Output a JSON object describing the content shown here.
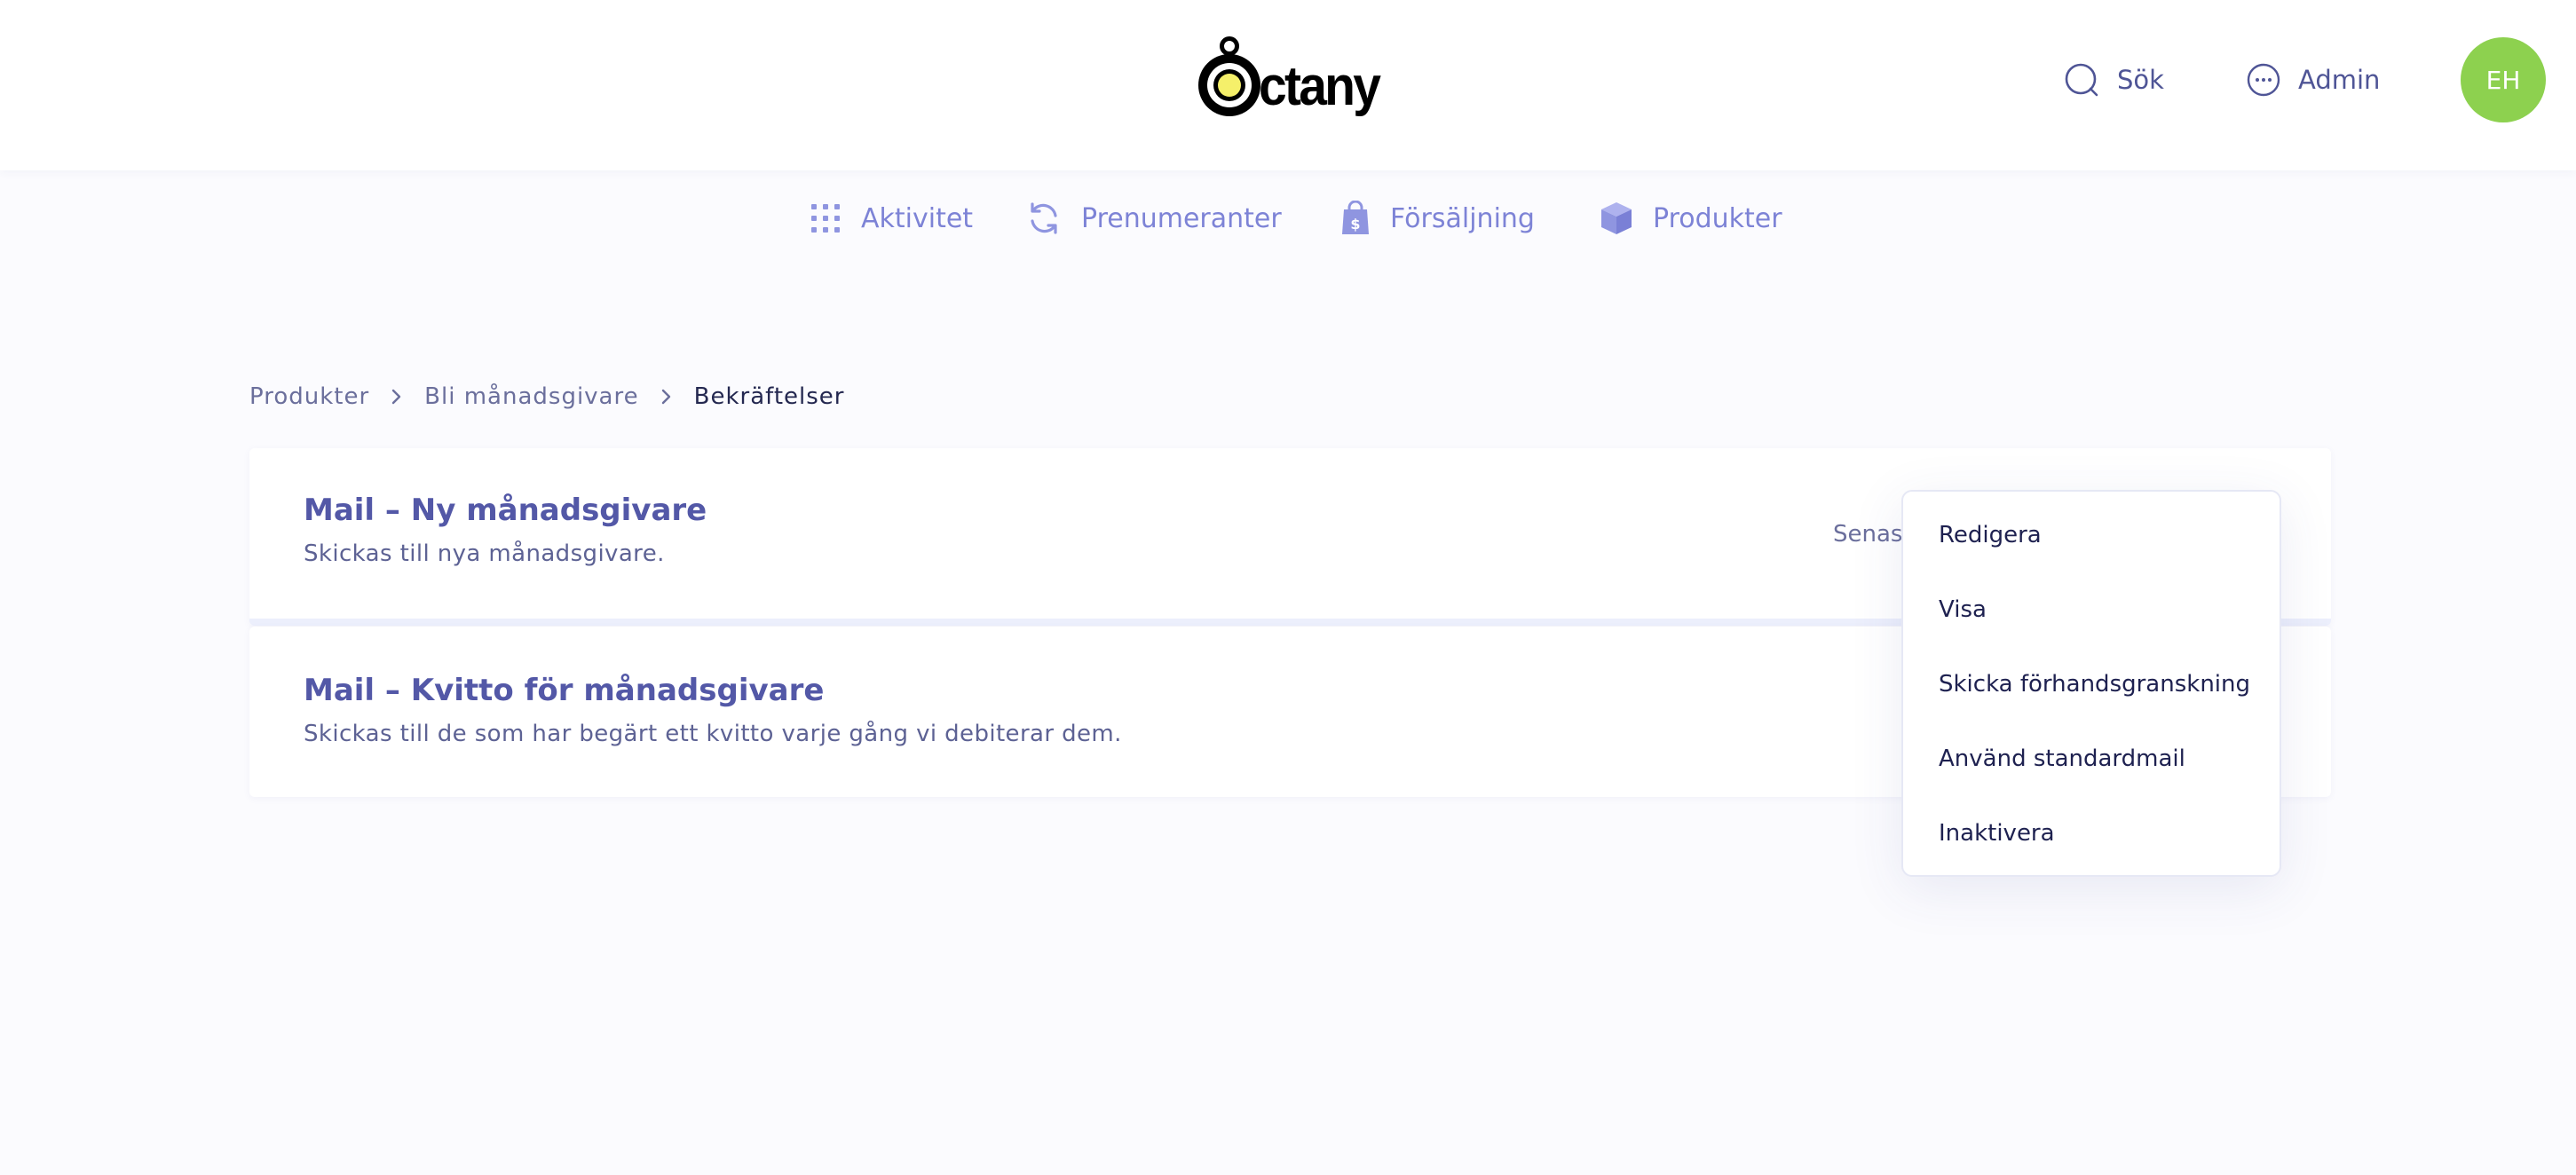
{
  "header": {
    "logo_text": "ctany",
    "search_label": "Sök",
    "admin_label": "Admin",
    "avatar_initials": "EH",
    "avatar_color": "#8dd14f"
  },
  "nav": {
    "items": [
      {
        "label": "Aktivitet",
        "icon": "grid-dots-icon"
      },
      {
        "label": "Prenumeranter",
        "icon": "refresh-icon"
      },
      {
        "label": "Försäljning",
        "icon": "shopping-bag-icon"
      },
      {
        "label": "Produkter",
        "icon": "box-icon"
      }
    ],
    "color": "#7d83d6"
  },
  "breadcrumb": {
    "items": [
      "Produkter",
      "Bli månadsgivare",
      "Bekräftelser"
    ]
  },
  "cards": [
    {
      "title": "Mail – Ny månadsgivare",
      "subtitle": "Skickas till nya månadsgivare.",
      "meta": "Senast"
    },
    {
      "title": "Mail – Kvitto för månadsgivare",
      "subtitle": "Skickas till de som har begärt ett kvitto varje gång vi debiterar dem."
    }
  ],
  "dropdown": {
    "items": [
      "Redigera",
      "Visa",
      "Skicka förhandsgranskning",
      "Använd standardmail",
      "Inaktivera"
    ]
  }
}
